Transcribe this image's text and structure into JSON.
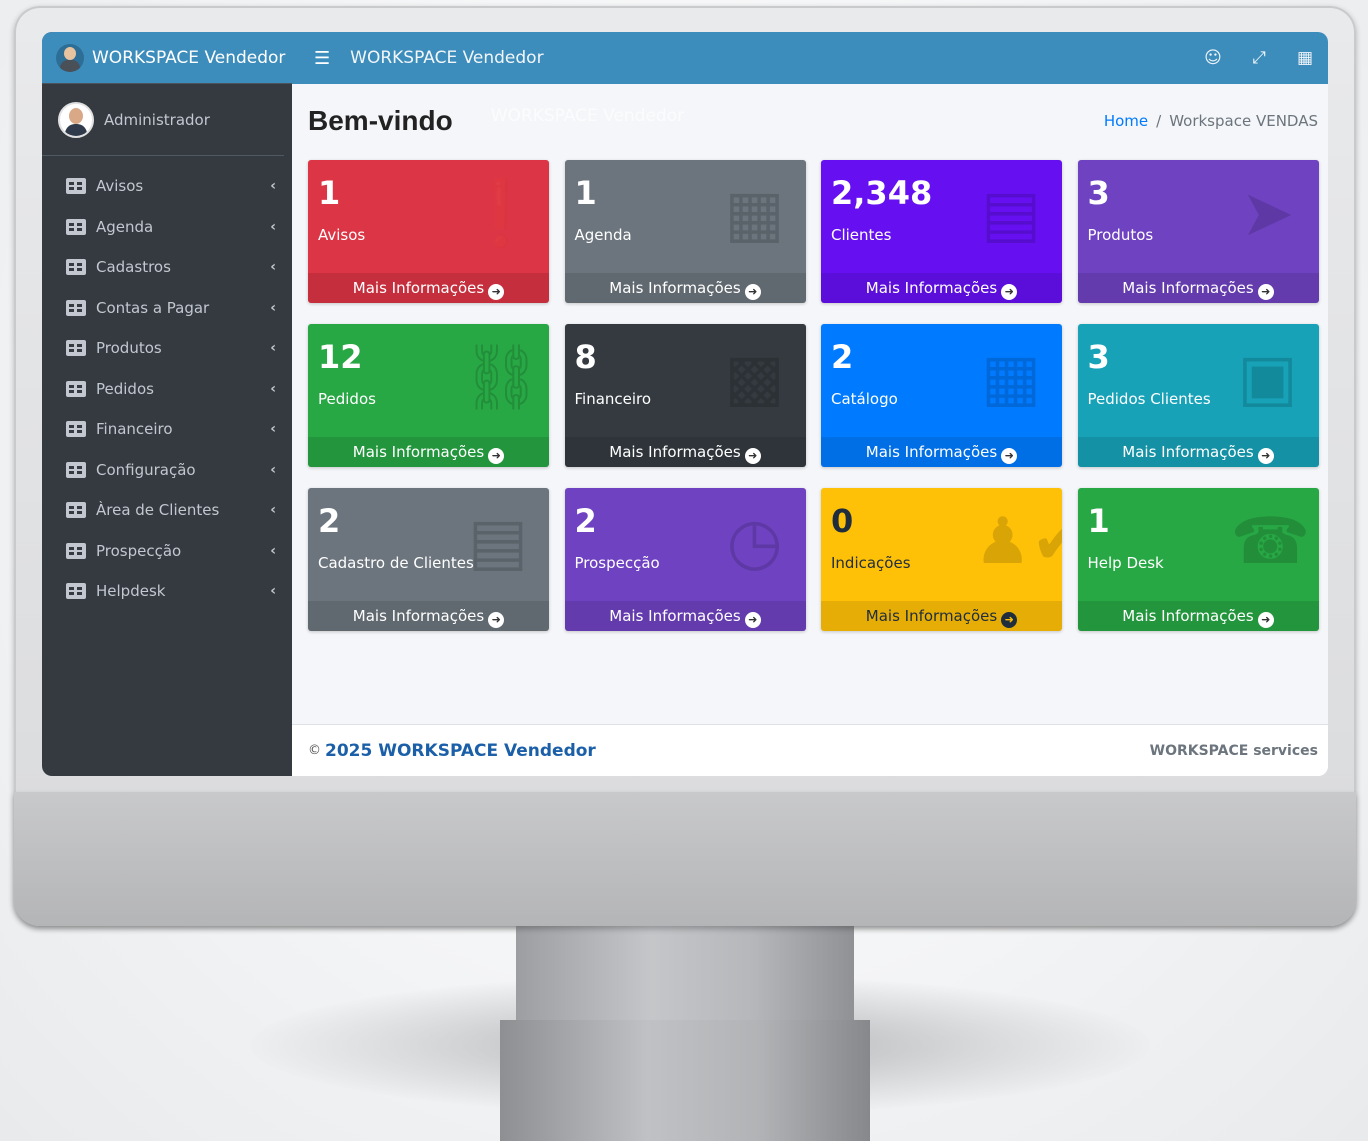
{
  "app": {
    "brand": "WORKSPACE Vendedor",
    "user": "Administrador"
  },
  "topbar": {
    "title": "WORKSPACE Vendedor",
    "icons": [
      "menu-icon",
      "user-icon",
      "fullscreen-icon",
      "apps-icon"
    ]
  },
  "sidebar": {
    "items": [
      {
        "label": "Avisos"
      },
      {
        "label": "Agenda"
      },
      {
        "label": "Cadastros"
      },
      {
        "label": "Contas a Pagar"
      },
      {
        "label": "Produtos"
      },
      {
        "label": "Pedidos"
      },
      {
        "label": "Financeiro"
      },
      {
        "label": "Configuração"
      },
      {
        "label": "Àrea de Clientes"
      },
      {
        "label": "Prospecção"
      },
      {
        "label": "Helpdesk"
      }
    ]
  },
  "header": {
    "title": "Bem-vindo",
    "ghost": "WORKSPACE Vendedor",
    "breadcrumb": {
      "home": "Home",
      "sep": "/",
      "current": "Workspace VENDAS"
    }
  },
  "boxes": [
    {
      "count": "1",
      "label": "Avisos",
      "color": "#dc3545",
      "icon": "alert-icon"
    },
    {
      "count": "1",
      "label": "Agenda",
      "color": "#6c757d",
      "icon": "calendar-icon"
    },
    {
      "count": "2,348",
      "label": "Clientes",
      "color": "#6610f2",
      "icon": "id-card-icon"
    },
    {
      "count": "3",
      "label": "Produtos",
      "color": "#6f42c1",
      "icon": "tags-icon"
    },
    {
      "count": "12",
      "label": "Pedidos",
      "color": "#28a745",
      "icon": "dolly-icon"
    },
    {
      "count": "8",
      "label": "Financeiro",
      "color": "#343a40",
      "icon": "chart-icon"
    },
    {
      "count": "2",
      "label": "Catálogo",
      "color": "#007bff",
      "icon": "images-icon"
    },
    {
      "count": "3",
      "label": "Pedidos Clientes",
      "color": "#17a2b8",
      "icon": "pallet-icon"
    },
    {
      "count": "2",
      "label": "Cadastro de Clientes",
      "color": "#6c757d",
      "icon": "id-card-icon"
    },
    {
      "count": "2",
      "label": "Prospecção",
      "color": "#6f42c1",
      "icon": "briefcase-clock-icon"
    },
    {
      "count": "0",
      "label": "Indicações",
      "color": "#ffc107",
      "icon": "user-check-icon"
    },
    {
      "count": "1",
      "label": "Help Desk",
      "color": "#28a745",
      "icon": "headset-icon"
    }
  ],
  "box_footer": "Mais Informações",
  "footer": {
    "copyright": "2025 WORKSPACE Vendedor",
    "right": "WORKSPACE services"
  }
}
